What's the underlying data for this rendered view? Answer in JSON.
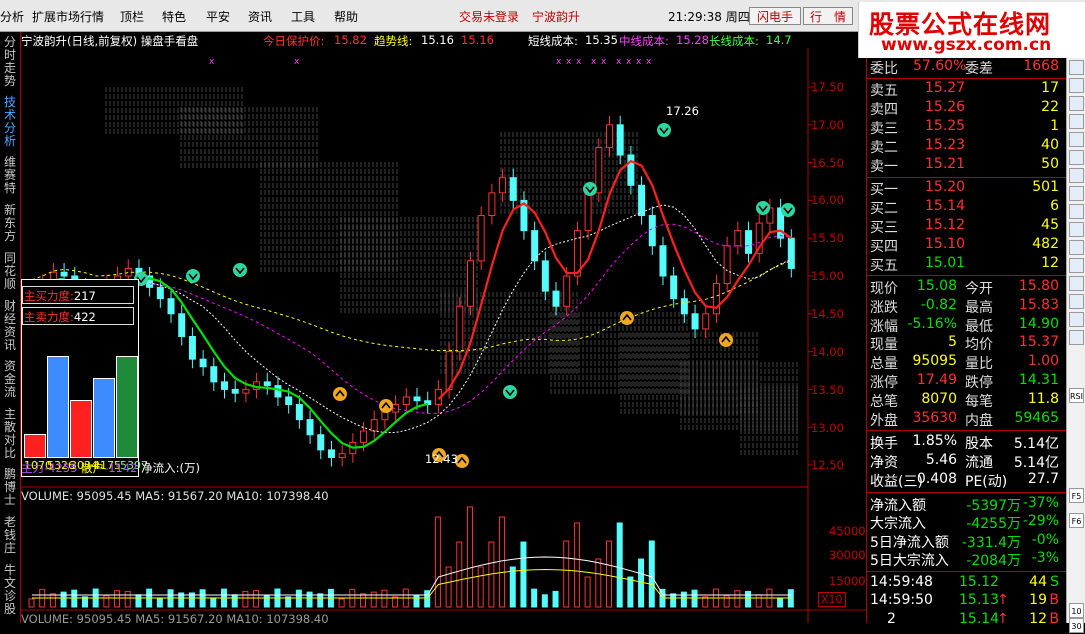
{
  "menubar": {
    "items": [
      "分析",
      "扩展市场行情",
      "顶栏",
      "特色",
      "平安",
      "资讯",
      "工具",
      "帮助"
    ],
    "trade_status": "交易未登录",
    "stock_name": "宁波韵升",
    "clock": "21:29:38 周四",
    "buttons": [
      "闪电手",
      "行　情"
    ]
  },
  "logo": {
    "line1": "股票公式在线网",
    "line2": "www.gszx.com.cn"
  },
  "sidebar": {
    "tabs": [
      "分时走势",
      "技术分析",
      "维赛特",
      "新东方",
      "同花顺",
      "财经资讯",
      "资金流",
      "主散对比",
      "鹏博士",
      "老钱庄",
      "牛文诊股"
    ]
  },
  "chart": {
    "info": {
      "title": "宁波韵升(日线,前复权) 操盘手看盘",
      "protect_label": "今日保护价:",
      "protect_value": "15.82",
      "trend_label": "趋势线:",
      "trend_value": "15.16",
      "trend_value2": "15.16",
      "short_cost_label": "短线成本:",
      "short_cost_value": "15.35",
      "mid_cost_label": "中线成本:",
      "mid_cost_value": "15.28",
      "long_cost_label": "长线成本:",
      "long_cost_value": "14.7"
    },
    "price_axis": [
      "17.50",
      "17.00",
      "16.50",
      "16.00",
      "15.50",
      "15.00",
      "14.50",
      "14.00",
      "13.50",
      "13.00",
      "12.50"
    ],
    "volume_axis": [
      "45000",
      "30000",
      "15000"
    ],
    "volume_scale": "X10",
    "high_label": "17.26",
    "low_label": "12.43",
    "volume_header": "VOLUME: 95095.45  MA5: 91567.20  MA10: 107398.40",
    "volume_header2": "VOLUME: 95095.45  MA5: 91567.20  MA10: 107398.40",
    "colors": {
      "up": "#ff3232",
      "down": "#54fcfc",
      "ma_short": "#ffffff",
      "ma_mid": "#ff00ff",
      "ma_long": "#ffff00"
    }
  },
  "force_panel": {
    "buy_label": "主买力度:",
    "buy_value": "217",
    "sell_label": "主卖力度:",
    "sell_value": "422",
    "bars": [
      {
        "value": "1070",
        "color": "#ff2020",
        "height": 0.24
      },
      {
        "value": "5326",
        "color": "#3c8cff",
        "height": 1.0
      },
      {
        "value": "3034",
        "color": "#ff2020",
        "height": 0.57
      },
      {
        "value": "4175",
        "color": "#3c8cff",
        "height": 0.78
      },
      {
        "value": "-5397",
        "color": "#1f8a3a",
        "height": 1.0
      }
    ],
    "main_label": "主力",
    "main_value": "-4255",
    "retail_label": "散户",
    "retail_value": "-1142",
    "net_label": "净流入:(万)"
  },
  "quote": {
    "weibi": {
      "label": "委比",
      "value": "57.60%",
      "label2": "委差",
      "value2": "1668"
    },
    "sells": [
      {
        "label": "卖五",
        "price": "15.27",
        "vol": "17"
      },
      {
        "label": "卖四",
        "price": "15.26",
        "vol": "22"
      },
      {
        "label": "卖三",
        "price": "15.25",
        "vol": "1"
      },
      {
        "label": "卖二",
        "price": "15.23",
        "vol": "40"
      },
      {
        "label": "卖一",
        "price": "15.21",
        "vol": "50"
      }
    ],
    "buys": [
      {
        "label": "买一",
        "price": "15.20",
        "vol": "501"
      },
      {
        "label": "买二",
        "price": "15.14",
        "vol": "6"
      },
      {
        "label": "买三",
        "price": "15.12",
        "vol": "45"
      },
      {
        "label": "买四",
        "price": "15.10",
        "vol": "482"
      },
      {
        "label": "买五",
        "price": "15.01",
        "vol": "12"
      }
    ],
    "stats": [
      {
        "l1": "现价",
        "v1": "15.08",
        "c1": "#00e000",
        "l2": "今开",
        "v2": "15.80",
        "c2": "#ff3030"
      },
      {
        "l1": "涨跌",
        "v1": "-0.82",
        "c1": "#00e000",
        "l2": "最高",
        "v2": "15.83",
        "c2": "#ff3030"
      },
      {
        "l1": "涨幅",
        "v1": "-5.16%",
        "c1": "#00e000",
        "l2": "最低",
        "v2": "14.90",
        "c2": "#00e000"
      },
      {
        "l1": "现量",
        "v1": "5",
        "c1": "#ffff00",
        "l2": "均价",
        "v2": "15.37",
        "c2": "#ff3030"
      },
      {
        "l1": "总量",
        "v1": "95095",
        "c1": "#ffff00",
        "l2": "量比",
        "v2": "1.00",
        "c2": "#ff3030"
      },
      {
        "l1": "涨停",
        "v1": "17.49",
        "c1": "#ff3030",
        "l2": "跌停",
        "v2": "14.31",
        "c2": "#00e000"
      },
      {
        "l1": "总笔",
        "v1": "8070",
        "c1": "#ffff00",
        "l2": "每笔",
        "v2": "11.8",
        "c2": "#ffff00"
      },
      {
        "l1": "外盘",
        "v1": "35630",
        "c1": "#ff3030",
        "l2": "内盘",
        "v2": "59465",
        "c2": "#00e000"
      }
    ],
    "stats2": [
      {
        "l1": "换手",
        "v1": "1.85%",
        "l2": "股本",
        "v2": "5.14亿"
      },
      {
        "l1": "净资",
        "v1": "5.46",
        "l2": "流通",
        "v2": "5.14亿"
      },
      {
        "l1": "收益(三)",
        "v1": "0.408",
        "l2": "PE(动)",
        "v2": "27.7"
      }
    ],
    "flows": [
      {
        "label": "净流入额",
        "value": "-5397万",
        "pct": "-37%"
      },
      {
        "label": "大宗流入",
        "value": "-4255万",
        "pct": "-29%"
      },
      {
        "label": "5日净流入额",
        "value": "-331.4万",
        "pct": "-0%"
      },
      {
        "label": "5日大宗流入",
        "value": "-2084万",
        "pct": "-3%"
      }
    ],
    "ticks": [
      {
        "time": "14:59:48",
        "price": "15.12",
        "arrow": "",
        "vol": "44",
        "flag": "S"
      },
      {
        "time": "14:59:50",
        "price": "15.13",
        "arrow": "↑",
        "vol": "19",
        "flag": "B"
      },
      {
        "time": "2",
        "price": "15.14",
        "arrow": "↑",
        "vol": "12",
        "flag": "B"
      }
    ]
  },
  "rightstrip": {
    "icons": [
      "RSI",
      "F5",
      "F6",
      "10",
      "30"
    ]
  }
}
